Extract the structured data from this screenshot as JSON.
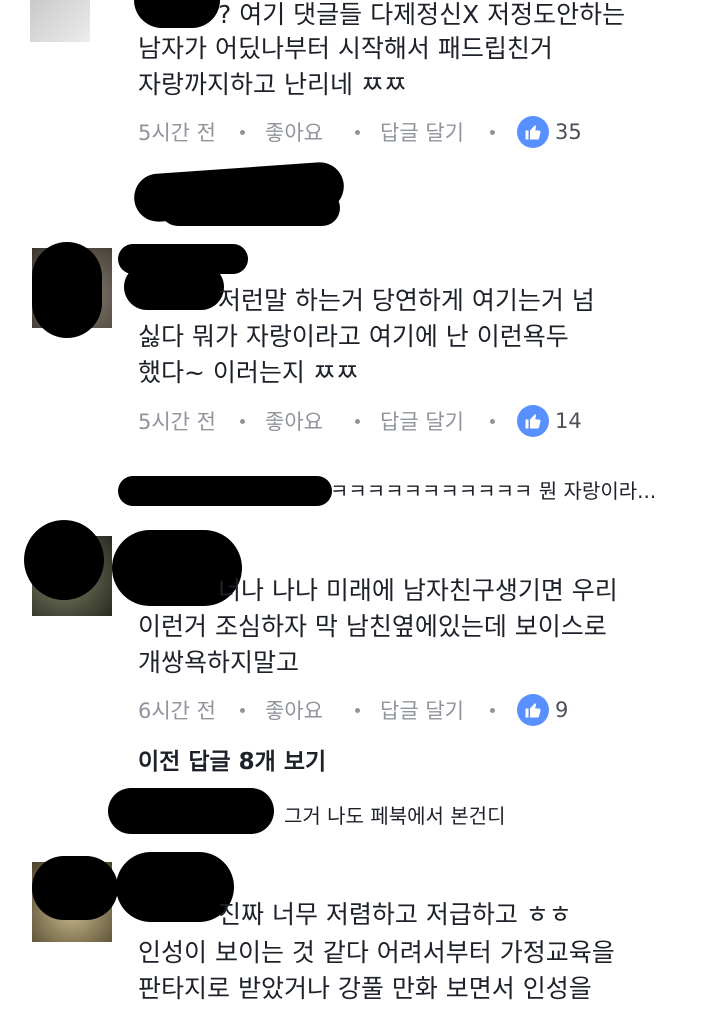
{
  "comments": [
    {
      "lines": [
        "? 여기 댓글들 다제정신X 저정도안하는",
        "남자가 어딨나부터 시작해서 패드립친거",
        "자랑까지하고 난리네 ㅉㅉ"
      ],
      "time": "5시간 전",
      "like_label": "좋아요",
      "reply_label": "답글 달기",
      "like_count": "35"
    },
    {
      "lines": [
        "저런말 하는거 당연하게 여기는거 넘",
        "싫다 뭐가 자랑이라고 여기에 난 이런욕두",
        "했다~ 이러는지 ㅉㅉ"
      ],
      "time": "5시간 전",
      "like_label": "좋아요",
      "reply_label": "답글 달기",
      "like_count": "14"
    },
    {
      "lines": [
        "너나 나나 미래에 남자친구생기면 우리",
        "이런거 조심하자 막 남친옆에있는데 보이스로",
        "개쌍욕하지말고"
      ],
      "time": "6시간 전",
      "like_label": "좋아요",
      "reply_label": "답글 달기",
      "like_count": "9"
    },
    {
      "lines": [
        "진짜 너무 저렴하고 저급하고 ㅎㅎ",
        "인성이 보이는 것 같다 어려서부터 가정교육을",
        "판타지로 받았거나 강풀 만화 보면서 인성을"
      ]
    }
  ],
  "reply_previews": [
    {
      "text": "ㅋㅋㅋㅋㅋㅋㅋㅋㅋㅋㅋ 뭔 자랑이라..."
    },
    {
      "text": "그거 나도 페북에서 본건디"
    }
  ],
  "view_previous": "이전 답글 8개 보기",
  "colors": {
    "text": "#1d2129",
    "meta": "#90949c",
    "like_badge": "#5890ff"
  },
  "icons": [
    "thumbs-up-icon"
  ]
}
